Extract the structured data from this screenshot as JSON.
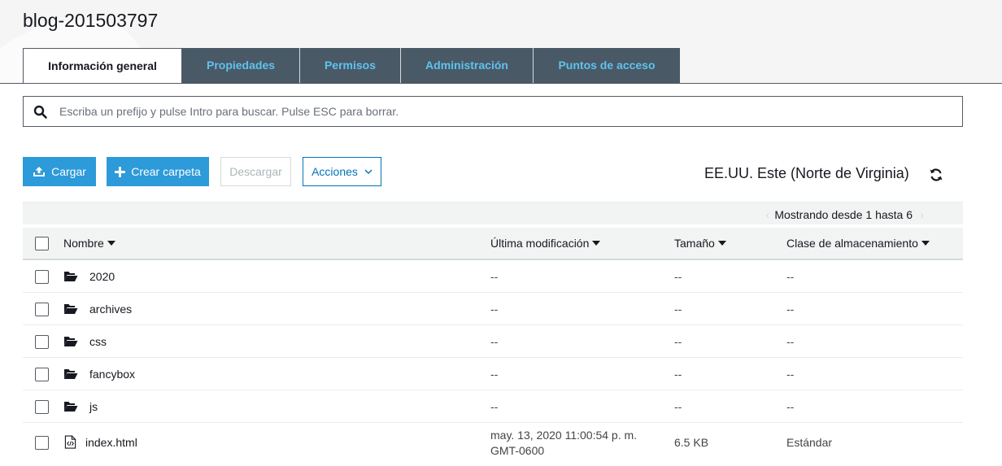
{
  "bucket": {
    "title": "blog-201503797"
  },
  "tabs": [
    {
      "label": "Información general",
      "active": true
    },
    {
      "label": "Propiedades"
    },
    {
      "label": "Permisos"
    },
    {
      "label": "Administración"
    },
    {
      "label": "Puntos de acceso"
    }
  ],
  "search": {
    "placeholder": "Escriba un prefijo y pulse Intro para buscar. Pulse ESC para borrar.",
    "icon": "search-icon"
  },
  "toolbar": {
    "upload_label": "Cargar",
    "create_folder_label": "Crear carpeta",
    "download_label": "Descargar",
    "actions_label": "Acciones"
  },
  "region": {
    "label": "EE.UU. Este (Norte de Virginia)"
  },
  "pager": {
    "text": "Mostrando desde 1 hasta 6"
  },
  "table": {
    "columns": {
      "name": "Nombre",
      "modified": "Última modificación",
      "size": "Tamaño",
      "storage": "Clase de almacenamiento"
    },
    "rows": [
      {
        "name": "2020",
        "modified": "--",
        "size": "--",
        "storage": "--",
        "type": "folder"
      },
      {
        "name": "archives",
        "modified": "--",
        "size": "--",
        "storage": "--",
        "type": "folder"
      },
      {
        "name": "css",
        "modified": "--",
        "size": "--",
        "storage": "--",
        "type": "folder"
      },
      {
        "name": "fancybox",
        "modified": "--",
        "size": "--",
        "storage": "--",
        "type": "folder"
      },
      {
        "name": "js",
        "modified": "--",
        "size": "--",
        "storage": "--",
        "type": "folder"
      },
      {
        "name": "index.html",
        "modified_line1": "may. 13, 2020 11:00:54 p. m.",
        "modified_line2": "GMT-0600",
        "size": "6.5 KB",
        "storage": "Estándar",
        "type": "file"
      }
    ]
  },
  "colors": {
    "tab_bg": "#4a5966",
    "tab_text": "#5dc3f0",
    "primary_button": "#2d9ad9",
    "link_blue": "#0073bb"
  }
}
